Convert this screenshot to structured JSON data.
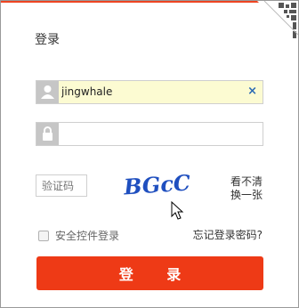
{
  "login": {
    "title": "登录",
    "username": {
      "value": "jingwhale",
      "clear_label": "×"
    },
    "password": {
      "value": ""
    },
    "captcha": {
      "placeholder": "验证码",
      "image_text": "BGcC",
      "refresh_line1": "看不清",
      "refresh_line2": "换一张"
    },
    "remember_label": "安全控件登录",
    "forgot_label": "忘记登录密码?",
    "submit_label": "登 录"
  },
  "colors": {
    "accent": "#ee3a16",
    "username_bg": "#fcfbd2",
    "captcha_text": "#1f4fbf"
  }
}
